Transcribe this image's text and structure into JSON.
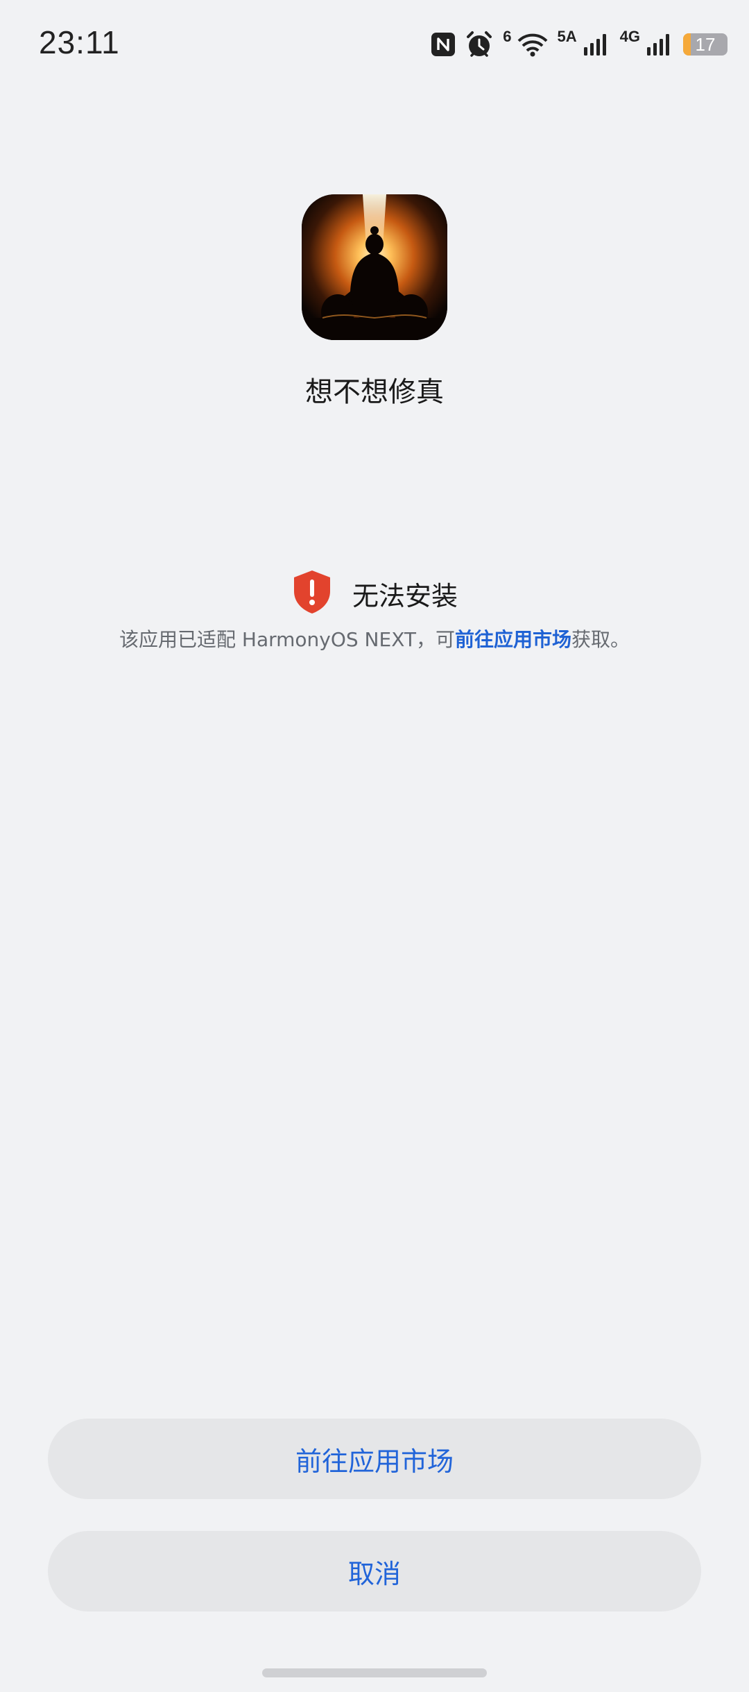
{
  "status_bar": {
    "time": "23:11",
    "icons": [
      "nfc-icon",
      "alarm-icon",
      "wifi-icon",
      "signal-5a-icon",
      "signal-4g-icon",
      "battery-icon"
    ],
    "wifi_label": "6",
    "signal1_label": "5A",
    "signal2_label": "4G",
    "battery_level": "17",
    "battery_fraction": 0.17,
    "battery_color": "#f5a93a"
  },
  "app": {
    "name": "想不想修真",
    "icon": "meditating-figure-app-icon"
  },
  "notice": {
    "icon": "warning-shield-icon",
    "title": "无法安装",
    "desc_prefix": "该应用已适配 HarmonyOS NEXT，可",
    "desc_link": "前往应用市场",
    "desc_suffix": "获取。"
  },
  "buttons": {
    "market": "前往应用市场",
    "cancel": "取消"
  },
  "colors": {
    "accent": "#2164d9",
    "warning": "#e2432d",
    "background": "#f1f2f4",
    "button_bg": "#e5e6e8"
  }
}
